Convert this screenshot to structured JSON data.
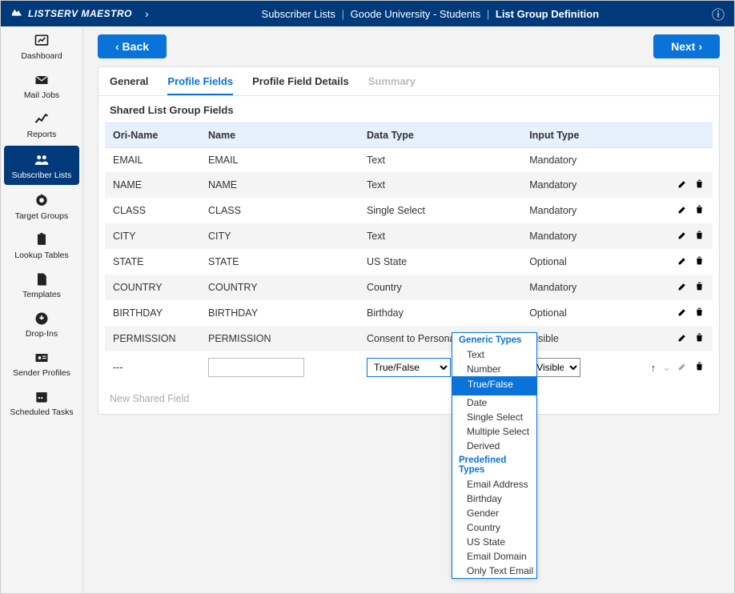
{
  "app_name": "LISTSERV MAESTRO",
  "breadcrumb": {
    "a": "Subscriber Lists",
    "b": "Goode University - Students",
    "c": "List Group Definition"
  },
  "buttons": {
    "back": "‹ Back",
    "next": "Next ›"
  },
  "sidebar": [
    {
      "id": "dashboard",
      "label": "Dashboard"
    },
    {
      "id": "mailjobs",
      "label": "Mail Jobs"
    },
    {
      "id": "reports",
      "label": "Reports"
    },
    {
      "id": "subscriberlists",
      "label": "Subscriber Lists",
      "active": true
    },
    {
      "id": "targetgroups",
      "label": "Target Groups"
    },
    {
      "id": "lookuptables",
      "label": "Lookup Tables"
    },
    {
      "id": "templates",
      "label": "Templates"
    },
    {
      "id": "dropins",
      "label": "Drop-Ins"
    },
    {
      "id": "senderprofiles",
      "label": "Sender Profiles"
    },
    {
      "id": "scheduledtasks",
      "label": "Scheduled Tasks"
    }
  ],
  "tabs": [
    {
      "label": "General"
    },
    {
      "label": "Profile Fields",
      "active": true
    },
    {
      "label": "Profile Field Details"
    },
    {
      "label": "Summary",
      "disabled": true
    }
  ],
  "section_title": "Shared List Group Fields",
  "columns": {
    "ori": "Ori-Name",
    "name": "Name",
    "dtype": "Data Type",
    "itype": "Input Type"
  },
  "rows": [
    {
      "ori": "EMAIL",
      "name": "EMAIL",
      "dtype": "Text",
      "itype": "Mandatory",
      "icons": false
    },
    {
      "ori": "NAME",
      "name": "NAME",
      "dtype": "Text",
      "itype": "Mandatory",
      "icons": true
    },
    {
      "ori": "CLASS",
      "name": "CLASS",
      "dtype": "Single Select",
      "itype": "Mandatory",
      "icons": true
    },
    {
      "ori": "CITY",
      "name": "CITY",
      "dtype": "Text",
      "itype": "Mandatory",
      "icons": true
    },
    {
      "ori": "STATE",
      "name": "STATE",
      "dtype": "US State",
      "itype": "Optional",
      "icons": true
    },
    {
      "ori": "COUNTRY",
      "name": "COUNTRY",
      "dtype": "Country",
      "itype": "Mandatory",
      "icons": true
    },
    {
      "ori": "BIRTHDAY",
      "name": "BIRTHDAY",
      "dtype": "Birthday",
      "itype": "Optional",
      "icons": true
    },
    {
      "ori": "PERMISSION",
      "name": "PERMISSION",
      "dtype": "Consent to Personal Tracking",
      "itype": "Visible",
      "icons": true
    }
  ],
  "new_row": {
    "ori": "---",
    "name_value": "",
    "dtype_selected": "True/False",
    "itype_selected": "Visible"
  },
  "new_link": "New Shared Field",
  "dropdown": {
    "groups": [
      {
        "title": "Generic Types",
        "opts": [
          "Text",
          "Number",
          "True/False",
          "Date",
          "Single Select",
          "Multiple Select",
          "Derived"
        ]
      },
      {
        "title": "Predefined Types",
        "opts": [
          "Email Address",
          "Birthday",
          "Gender",
          "Country",
          "US State",
          "Email Domain",
          "Only Text Email"
        ]
      }
    ],
    "selected": "True/False"
  }
}
